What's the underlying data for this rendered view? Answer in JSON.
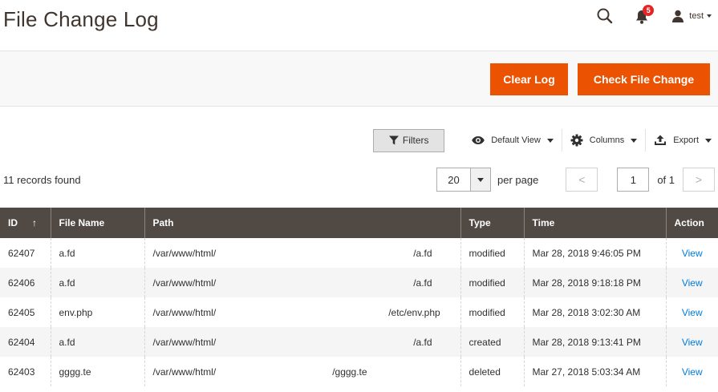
{
  "page": {
    "title": "File Change Log"
  },
  "header": {
    "notification_count": "5",
    "user_name": "test"
  },
  "actions": {
    "clear_log_label": "Clear Log",
    "check_file_change_label": "Check File Change"
  },
  "toolbar": {
    "filters_label": "Filters",
    "view_label": "Default View",
    "columns_label": "Columns",
    "export_label": "Export"
  },
  "grid": {
    "records_found": "11 records found",
    "per_page_value": "20",
    "per_page_label": "per page",
    "prev_label": "<",
    "next_label": ">",
    "current_page": "1",
    "total_pages_label": "of 1",
    "columns": {
      "id": "ID",
      "sort_indicator": "↑",
      "file_name": "File Name",
      "path": "Path",
      "type": "Type",
      "time": "Time",
      "action": "Action"
    },
    "rows": [
      {
        "id": "62407",
        "file_name": "a.fd",
        "path_start": "/var/www/html/",
        "path_end": "/a.fd",
        "type": "modified",
        "time": "Mar 28, 2018 9:46:05 PM",
        "action": "View"
      },
      {
        "id": "62406",
        "file_name": "a.fd",
        "path_start": "/var/www/html/",
        "path_end": "/a.fd",
        "type": "modified",
        "time": "Mar 28, 2018 9:18:18 PM",
        "action": "View"
      },
      {
        "id": "62405",
        "file_name": "env.php",
        "path_start": "/var/www/html/",
        "path_end": "/etc/env.php",
        "type": "modified",
        "time": "Mar 28, 2018 3:02:30 AM",
        "action": "View"
      },
      {
        "id": "62404",
        "file_name": "a.fd",
        "path_start": "/var/www/html/",
        "path_end": "/a.fd",
        "type": "created",
        "time": "Mar 28, 2018 9:13:41 PM",
        "action": "View"
      },
      {
        "id": "62403",
        "file_name": "gggg.te",
        "path_start": "/var/www/html/",
        "path_end": "/gggg.te",
        "type": "deleted",
        "time": "Mar 27, 2018 5:03:34 AM",
        "action": "View"
      }
    ]
  },
  "colors": {
    "accent": "#eb5202",
    "table_header": "#514943",
    "link": "#007bdb",
    "badge": "#e22626"
  }
}
